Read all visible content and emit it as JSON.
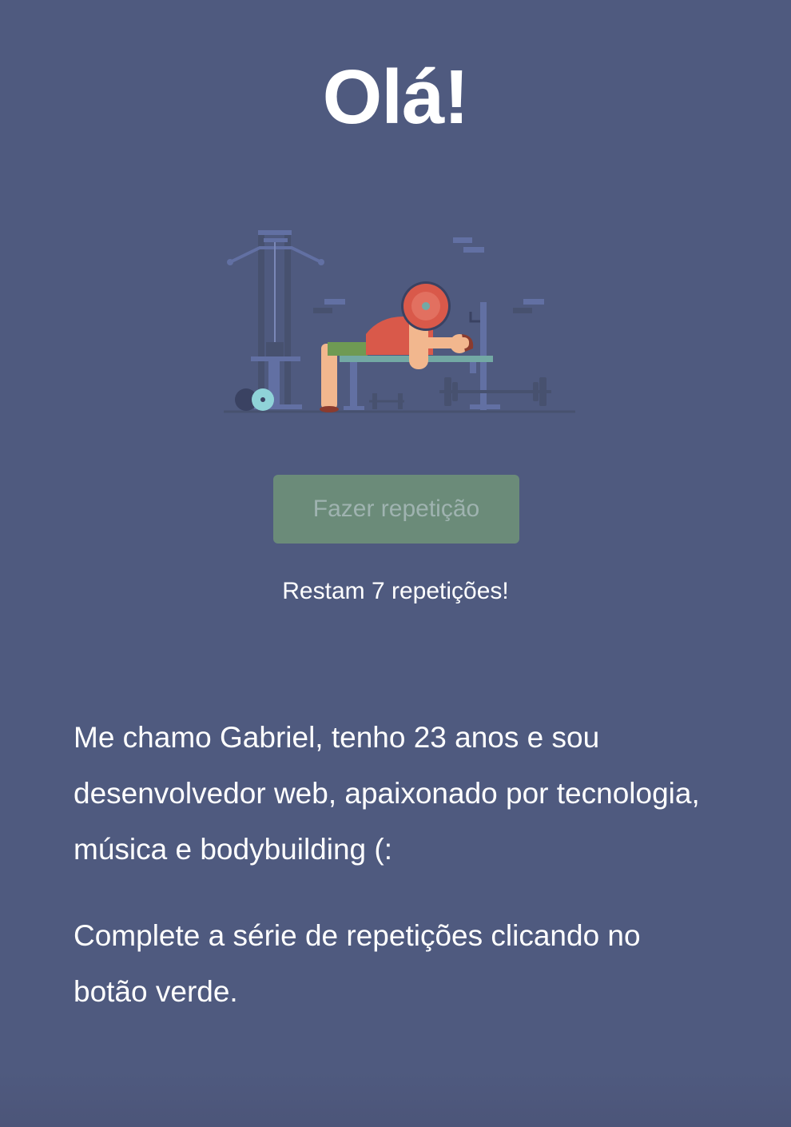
{
  "hero": {
    "title": "Olá!",
    "illustration_icon": "bench-press-illustration"
  },
  "workout": {
    "button_label": "Fazer repetição",
    "counter_text": "Restam 7 repetições!",
    "remaining_reps": 7
  },
  "about": {
    "bio": "Me chamo Gabriel, tenho 23 anos e sou desenvolvedor web, apaixonado por tecnologia, música e bodybuilding (:",
    "hint": "Complete a série de repetições clicando no botão verde."
  },
  "colors": {
    "background": "#4f5a7f",
    "button": "#6b8b79",
    "button_text": "#9fb3b0",
    "text": "#ffffff"
  }
}
